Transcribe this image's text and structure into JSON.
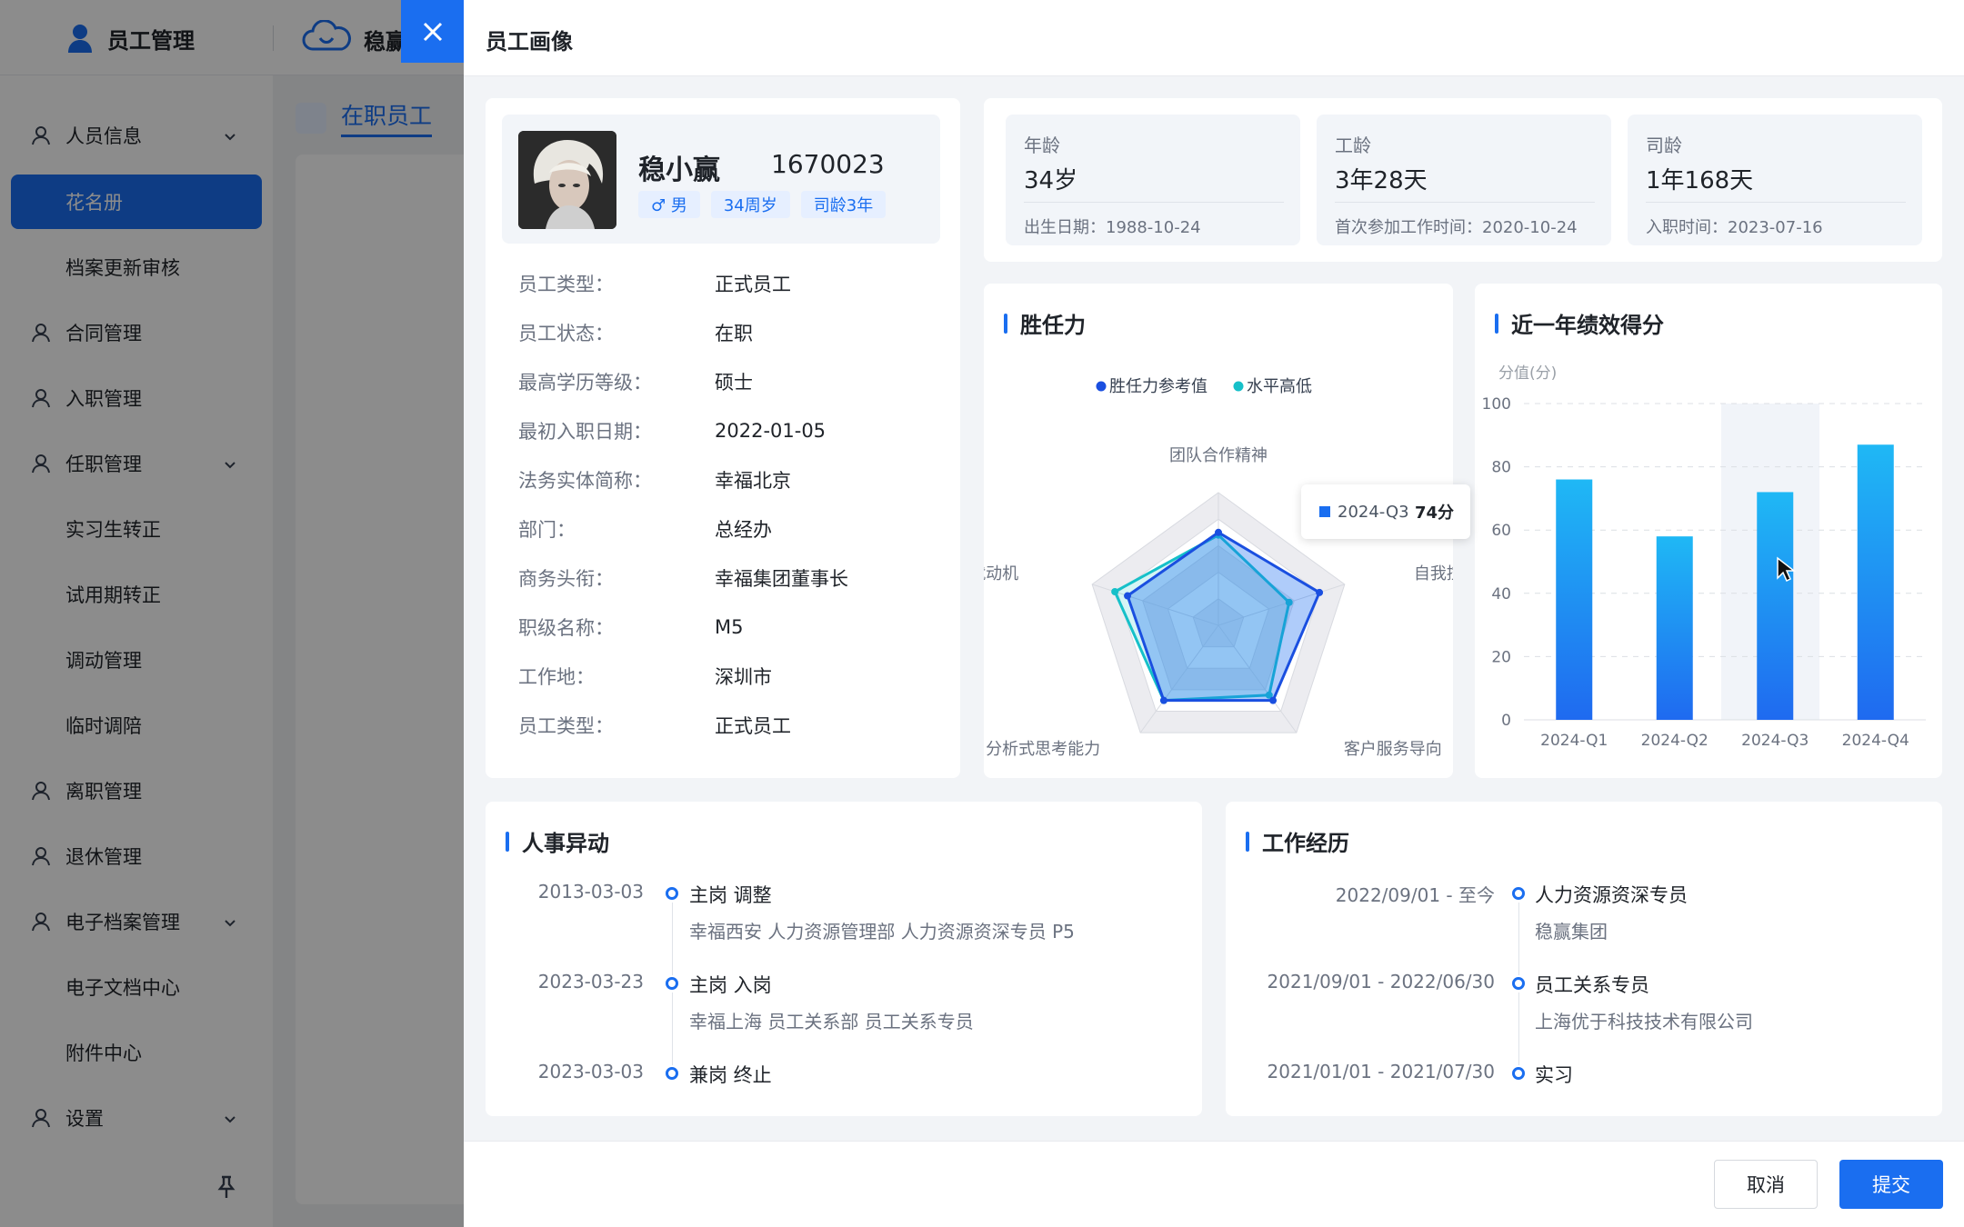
{
  "app": {
    "title": "员工管理",
    "brand": "稳赢"
  },
  "sidebar": {
    "items": [
      {
        "label": "人员信息",
        "icon": "user-icon",
        "expandable": true
      },
      {
        "label": "花名册",
        "sub": true,
        "active": true
      },
      {
        "label": "档案更新审核",
        "sub": true
      },
      {
        "label": "合同管理",
        "icon": "document-icon"
      },
      {
        "label": "入职管理",
        "icon": "user-add-icon"
      },
      {
        "label": "任职管理",
        "icon": "user-badge-icon",
        "expandable": true
      },
      {
        "label": "实习生转正",
        "sub": true
      },
      {
        "label": "试用期转正",
        "sub": true
      },
      {
        "label": "调动管理",
        "sub": true
      },
      {
        "label": "临时调陪",
        "sub": true
      },
      {
        "label": "离职管理",
        "icon": "user-remove-icon"
      },
      {
        "label": "退休管理",
        "icon": "retire-icon"
      },
      {
        "label": "电子档案管理",
        "icon": "archive-icon",
        "expandable": true
      },
      {
        "label": "电子文档中心",
        "sub": true
      },
      {
        "label": "附件中心",
        "sub": true
      },
      {
        "label": "设置",
        "icon": "gear-icon",
        "expandable": true
      }
    ]
  },
  "content": {
    "tab_label": "在职员工"
  },
  "drawer": {
    "title": "员工画像",
    "profile": {
      "name": "稳小赢",
      "id": "1670023",
      "tags": [
        "♂ 男",
        "34周岁",
        "司龄3年"
      ]
    },
    "info": [
      {
        "label": "员工类型：",
        "value": "正式员工"
      },
      {
        "label": "员工状态：",
        "value": "在职"
      },
      {
        "label": "最高学历等级：",
        "value": "硕士"
      },
      {
        "label": "最初入职日期：",
        "value": "2022-01-05"
      },
      {
        "label": "法务实体简称：",
        "value": "幸福北京"
      },
      {
        "label": "部门：",
        "value": "总经办"
      },
      {
        "label": "商务头衔：",
        "value": "幸福集团董事长"
      },
      {
        "label": "职级名称：",
        "value": "M5"
      },
      {
        "label": "工作地：",
        "value": "深圳市"
      },
      {
        "label": "员工类型：",
        "value": "正式员工"
      }
    ],
    "stats": [
      {
        "label": "年龄",
        "value": "34岁",
        "sub": "出生日期：1988-10-24"
      },
      {
        "label": "工龄",
        "value": "3年28天",
        "sub": "首次参加工作时间：2020-10-24"
      },
      {
        "label": "司龄",
        "value": "1年168天",
        "sub": "入职时间：2023-07-16"
      }
    ],
    "competency": {
      "title": "胜任力",
      "legend": [
        "胜任力参考值",
        "水平高低"
      ],
      "colors": [
        "#1a4fe0",
        "#16c0c9"
      ]
    },
    "performance": {
      "title": "近一年绩效得分"
    },
    "hr_changes": {
      "title": "人事异动",
      "items": [
        {
          "date": "2013-03-03",
          "title": "主岗 调整",
          "sub": "幸福西安 人力资源管理部 人力资源资深专员 P5"
        },
        {
          "date": "2023-03-23",
          "title": "主岗 入岗",
          "sub": "幸福上海 员工关系部 员工关系专员"
        },
        {
          "date": "2023-03-03",
          "title": "兼岗 终止",
          "sub": ""
        }
      ]
    },
    "work_history": {
      "title": "工作经历",
      "items": [
        {
          "date": "2022/09/01 - 至今",
          "title": "人力资源资深专员",
          "sub": "稳赢集团"
        },
        {
          "date": "2021/09/01 - 2022/06/30",
          "title": "员工关系专员",
          "sub": "上海优于科技技术有限公司"
        },
        {
          "date": "2021/01/01 - 2021/07/30",
          "title": "实习",
          "sub": ""
        }
      ]
    },
    "tooltip": {
      "label": "2024-Q3",
      "value": "74分"
    },
    "buttons": {
      "cancel": "取消",
      "submit": "提交"
    }
  },
  "chart_data": [
    {
      "type": "radar",
      "title": "胜任力",
      "categories": [
        "团队合作精神",
        "自我控制",
        "客户服务导向",
        "分析式思考能力",
        "成就动机"
      ],
      "max": 100,
      "series": [
        {
          "name": "胜任力参考值",
          "values": [
            70,
            80,
            70,
            70,
            72
          ]
        },
        {
          "name": "水平高低",
          "values": [
            68,
            56,
            65,
            70,
            82
          ]
        }
      ]
    },
    {
      "type": "bar",
      "title": "近一年绩效得分",
      "ylabel": "分值(分)",
      "categories": [
        "2024-Q1",
        "2024-Q2",
        "2024-Q3",
        "2024-Q4"
      ],
      "values": [
        76,
        58,
        72,
        87
      ],
      "ylim": [
        0,
        100
      ],
      "yticks": [
        0,
        20,
        40,
        60,
        80,
        100
      ],
      "highlight": "2024-Q3"
    }
  ]
}
